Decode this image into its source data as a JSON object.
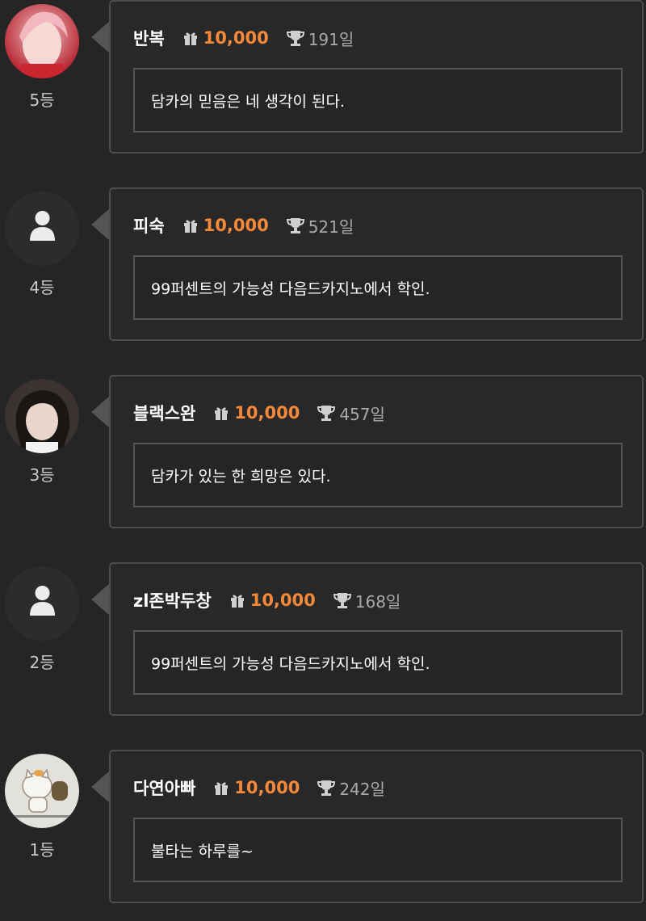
{
  "entries": [
    {
      "name": "반복",
      "amount": "10,000",
      "days": "191일",
      "message": "담카의 믿음은 네 생각이 된다.",
      "rank": "5등",
      "avatar": "photo-pink",
      "icons": {
        "gift": "gift-icon",
        "trophy": "trophy-icon"
      }
    },
    {
      "name": "피숙",
      "amount": "10,000",
      "days": "521일",
      "message": "99퍼센트의 가능성 다음드카지노에서 학인.",
      "rank": "4등",
      "avatar": "default-person"
    },
    {
      "name": "블랙스완",
      "amount": "10,000",
      "days": "457일",
      "message": "담카가 있는 한 희망은 있다.",
      "rank": "3등",
      "avatar": "photo-dark"
    },
    {
      "name": "zl존박두창",
      "amount": "10,000",
      "days": "168일",
      "message": "99퍼센트의 가능성 다음드카지노에서 학인.",
      "rank": "2등",
      "avatar": "default-person"
    },
    {
      "name": "다연아빠",
      "amount": "10,000",
      "days": "242일",
      "message": "불타는 하루를~",
      "rank": "1등",
      "avatar": "photo-cat"
    }
  ],
  "colors": {
    "background": "#252525",
    "accent": "#f5893a",
    "border": "#4d4d4d",
    "muted": "#a9a9a9"
  }
}
